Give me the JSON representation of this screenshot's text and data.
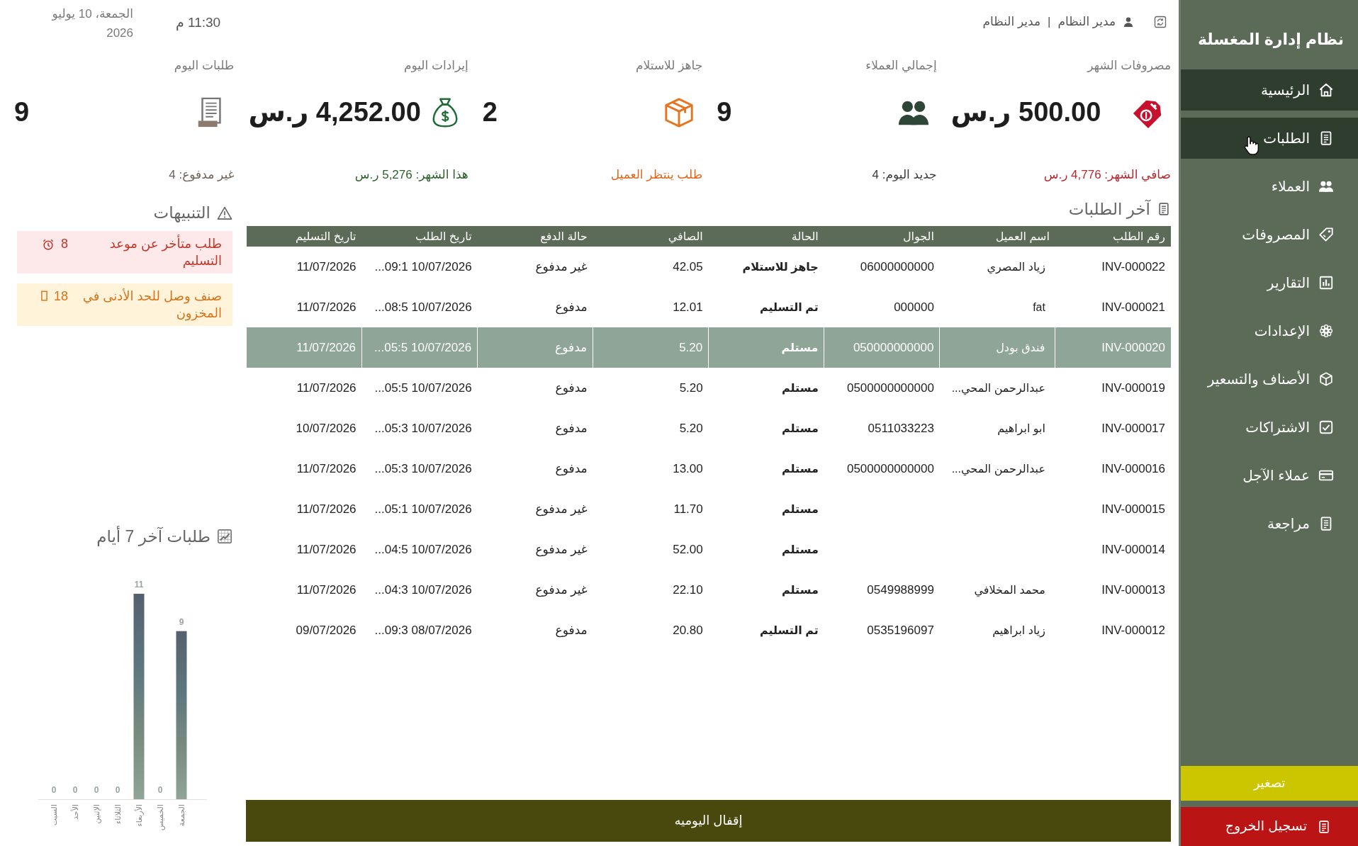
{
  "sidebar": {
    "title": "نظام إدارة المغسلة",
    "items": [
      {
        "label": "الرئيسية",
        "selected": true,
        "hovered": false
      },
      {
        "label": "الطلبات",
        "selected": true,
        "hovered": true
      },
      {
        "label": "العملاء",
        "selected": false,
        "hovered": false
      },
      {
        "label": "المصروفات",
        "selected": false,
        "hovered": false
      },
      {
        "label": "التقارير",
        "selected": false,
        "hovered": false
      },
      {
        "label": "الإعدادات",
        "selected": false,
        "hovered": false
      },
      {
        "label": "الأصناف والتسعير",
        "selected": false,
        "hovered": false
      },
      {
        "label": "الاشتراكات",
        "selected": false,
        "hovered": false
      },
      {
        "label": "عملاء الآجل",
        "selected": false,
        "hovered": false
      },
      {
        "label": "مراجعة",
        "selected": false,
        "hovered": false
      }
    ],
    "collapse_button": "تصغير",
    "logout_button": "تسجيل الخروج"
  },
  "header": {
    "user_name": "مدير النظام",
    "separator": "|",
    "user_role": "مدير النظام",
    "time": "11:30 م",
    "date": "الجمعة، 10 يوليو 2026"
  },
  "stats": [
    {
      "label": "مصروفات الشهر",
      "value": "500.00 ر.س",
      "note": "صافي الشهر: 4,776 ر.س",
      "color": "#b8282e"
    },
    {
      "label": "إجمالي العملاء",
      "value": "9",
      "note": "جديد اليوم: 4",
      "color": "#3a3a3a"
    },
    {
      "label": "جاهز للاستلام",
      "value": "2",
      "note": "طلب ينتظر العميل",
      "color": "#e0661a"
    },
    {
      "label": "إيرادات اليوم",
      "value": "4,252.00 ر.س",
      "note": "هذا الشهر: 5,276 ر.س",
      "color": "#2b5f2b"
    },
    {
      "label": "طلبات اليوم",
      "value": "9",
      "note": "غير مدفوع: 4",
      "color": "#6e6259"
    }
  ],
  "orders": {
    "title": "آخر الطلبات",
    "columns": [
      "رقم الطلب",
      "اسم العميل",
      "الجوال",
      "الحالة",
      "الصافي",
      "حالة الدفع",
      "تاريخ الطلب",
      "تاريخ التسليم"
    ],
    "rows": [
      {
        "number": "INV-000022",
        "customer": "زياد المصري",
        "phone": "06000000000",
        "status": "جاهز للاستلام",
        "net": "42.05",
        "payment": "غير مدفوع",
        "order_date": "10/07/2026 09:1...",
        "delivery_date": "11/07/2026",
        "selected": false
      },
      {
        "number": "INV-000021",
        "customer": "fat",
        "phone": "000000",
        "status": "تم التسليم",
        "net": "12.01",
        "payment": "مدفوع",
        "order_date": "10/07/2026 08:5...",
        "delivery_date": "11/07/2026",
        "selected": false
      },
      {
        "number": "INV-000020",
        "customer": "فندق بودل",
        "phone": "050000000000",
        "status": "مستلم",
        "net": "5.20",
        "payment": "مدفوع",
        "order_date": "10/07/2026 05:5...",
        "delivery_date": "11/07/2026",
        "selected": true
      },
      {
        "number": "INV-000019",
        "customer": "عبدالرحمن المحي...",
        "phone": "0500000000000",
        "status": "مستلم",
        "net": "5.20",
        "payment": "مدفوع",
        "order_date": "10/07/2026 05:5...",
        "delivery_date": "11/07/2026",
        "selected": false
      },
      {
        "number": "INV-000017",
        "customer": "ابو ابراهيم",
        "phone": "0511033223",
        "status": "مستلم",
        "net": "5.20",
        "payment": "مدفوع",
        "order_date": "10/07/2026 05:3...",
        "delivery_date": "10/07/2026",
        "selected": false
      },
      {
        "number": "INV-000016",
        "customer": "عبدالرحمن المحي...",
        "phone": "0500000000000",
        "status": "مستلم",
        "net": "13.00",
        "payment": "مدفوع",
        "order_date": "10/07/2026 05:3...",
        "delivery_date": "11/07/2026",
        "selected": false
      },
      {
        "number": "INV-000015",
        "status": "مستلم",
        "net": "11.70",
        "payment": "غير مدفوع",
        "order_date": "10/07/2026 05:1...",
        "delivery_date": "11/07/2026",
        "selected": false
      },
      {
        "number": "INV-000014",
        "status": "مستلم",
        "net": "52.00",
        "payment": "غير مدفوع",
        "order_date": "10/07/2026 04:5...",
        "delivery_date": "11/07/2026",
        "selected": false
      },
      {
        "number": "INV-000013",
        "customer": "محمد المخلافي",
        "phone": "0549988999",
        "status": "مستلم",
        "net": "22.10",
        "payment": "غير مدفوع",
        "order_date": "10/07/2026 04:3...",
        "delivery_date": "11/07/2026",
        "selected": false
      },
      {
        "number": "INV-000012",
        "customer": "زياد ابراهيم",
        "phone": "0535196097",
        "status": "تم التسليم",
        "net": "20.80",
        "payment": "مدفوع",
        "order_date": "08/07/2026 09:3...",
        "delivery_date": "09/07/2026",
        "selected": false
      }
    ]
  },
  "close_day_button": "إقفال اليوميه",
  "alerts": {
    "title": "التنبيهات",
    "items": [
      {
        "kind": "overdue",
        "count": "8",
        "text": "طلب متأخر عن موعد التسليم"
      },
      {
        "kind": "low_stock",
        "count": "18",
        "text": "صنف وصل للحد الأدنى في المخزون"
      }
    ]
  },
  "orders_chart": {
    "chart_data": {
      "type": "bar",
      "title": "طلبات آخر 7 أيام",
      "categories": [
        "السبت",
        "الأحد",
        "الإثنين",
        "الثلاثاء",
        "الأربعاء",
        "الخميس",
        "الجمعة"
      ],
      "values": [
        0,
        0,
        0,
        0,
        11,
        0,
        9
      ],
      "data_labels": true
    }
  }
}
